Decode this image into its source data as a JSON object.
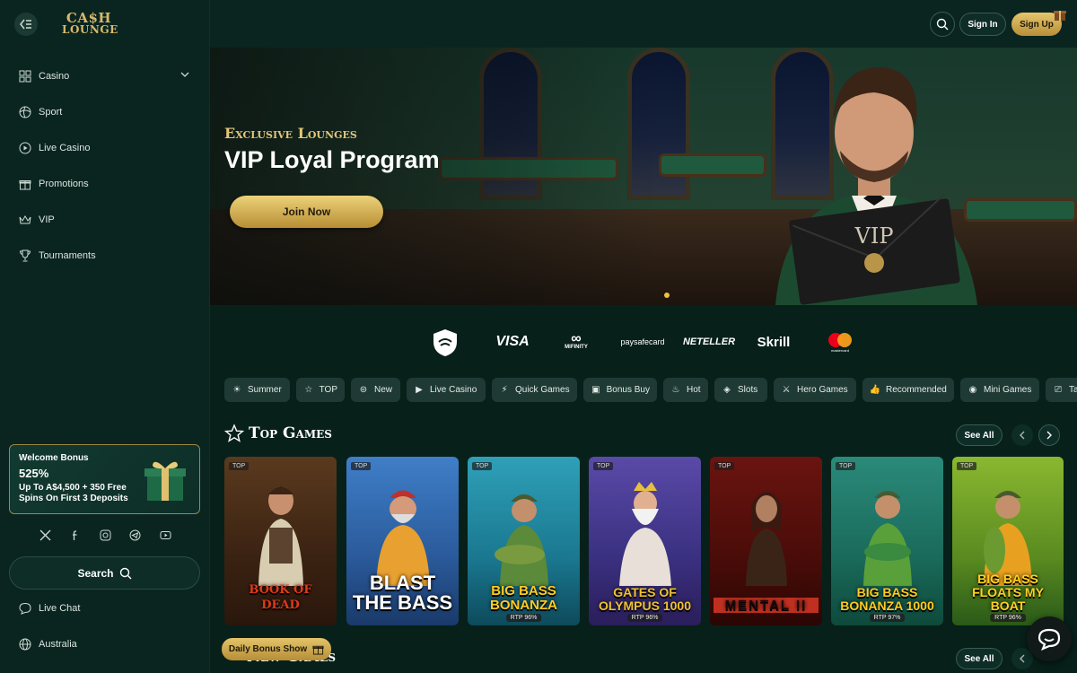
{
  "brand": {
    "line1": "CA$H",
    "line2": "LOUNGE"
  },
  "sidebar": {
    "items": [
      {
        "label": "Casino",
        "icon": "grid-icon"
      },
      {
        "label": "Sport",
        "icon": "ball-icon"
      },
      {
        "label": "Live Casino",
        "icon": "play-icon"
      },
      {
        "label": "Promotions",
        "icon": "gift-icon"
      },
      {
        "label": "VIP",
        "icon": "crown-icon"
      },
      {
        "label": "Tournaments",
        "icon": "trophy-icon"
      }
    ],
    "bonus": {
      "title": "Welcome Bonus",
      "percent": "525%",
      "desc": "Up To A$4,500 + 350 Free Spins On First 3 Deposits"
    },
    "search_label": "Search",
    "bottom": [
      {
        "label": "Live Chat",
        "icon": "chat-icon"
      },
      {
        "label": "Australia",
        "icon": "globe-icon"
      }
    ]
  },
  "header": {
    "signin": "Sign In",
    "signup": "Sign Up"
  },
  "hero": {
    "subtitle": "Exclusive Lounges",
    "title": "VIP Loyal Program",
    "button": "Join Now",
    "envelope": "VIP"
  },
  "payments": [
    "VISA",
    "MIFINITY",
    "paysafecard",
    "NETELLER",
    "Skrill",
    "mastercard"
  ],
  "categories": [
    "Summer",
    "TOP",
    "New",
    "Live Casino",
    "Quick Games",
    "Bonus Buy",
    "Hot",
    "Slots",
    "Hero Games",
    "Recommended",
    "Mini Games",
    "Ta"
  ],
  "top_games": {
    "title": "Top Games",
    "see_all": "See All",
    "games": [
      {
        "title": "BOOK OF DEAD",
        "badge": "TOP",
        "rtp": ""
      },
      {
        "title": "BLAST THE BASS",
        "badge": "TOP",
        "rtp": ""
      },
      {
        "title": "BIG BASS BONANZA",
        "badge": "TOP",
        "rtp": "RTP 96%"
      },
      {
        "title": "GATES OF OLYMPUS 1000",
        "badge": "TOP",
        "rtp": "RTP 96%"
      },
      {
        "title": "MENTAL II",
        "badge": "TOP",
        "rtp": ""
      },
      {
        "title": "BIG BASS BONANZA 1000",
        "badge": "TOP",
        "rtp": "RTP 97%"
      },
      {
        "title": "BIG BASS FLOATS MY BOAT",
        "badge": "TOP",
        "rtp": "RTP 96%"
      }
    ]
  },
  "daily_bonus": "Daily Bonus Show",
  "new_games": {
    "title": "New Games",
    "see_all": "See All"
  },
  "colors": {
    "accent_gold": "#d9b96a",
    "bg": "#07201a",
    "sidebar": "#0a2520"
  }
}
